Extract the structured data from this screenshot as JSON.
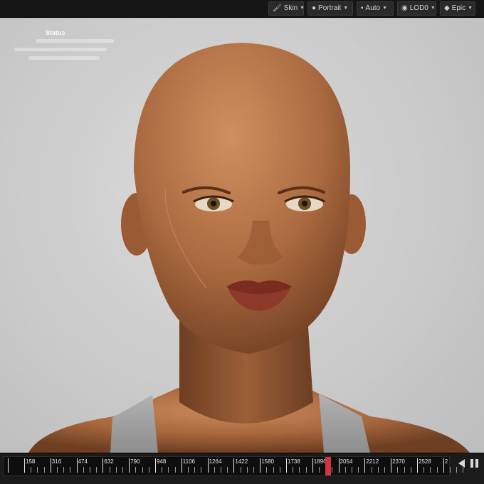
{
  "toolbar": {
    "skin_label": "Skin",
    "portrait_label": "Portrait",
    "auto_label": "Auto",
    "lod_label": "LOD0",
    "quality_label": "Epic"
  },
  "viewport": {
    "status_label": "Status"
  },
  "timeline": {
    "ticks": [
      "158",
      "316",
      "474",
      "632",
      "790",
      "948",
      "1106",
      "1264",
      "1422",
      "1580",
      "1738",
      "1896",
      "2054",
      "2212",
      "2370",
      "2528",
      "2"
    ],
    "first_mark": "|"
  }
}
